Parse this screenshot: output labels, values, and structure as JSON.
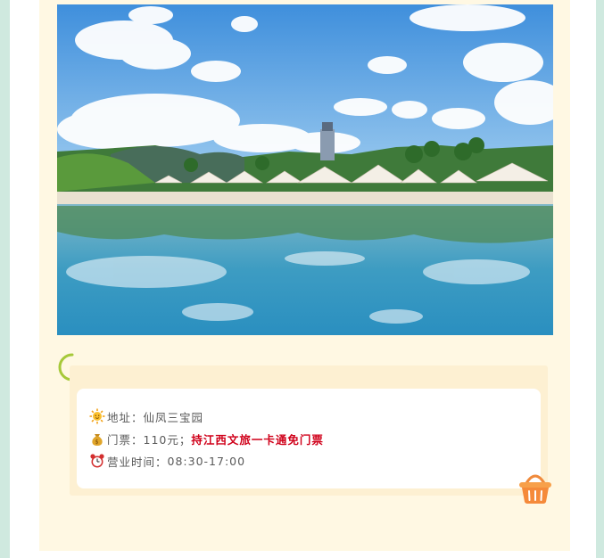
{
  "info": {
    "address_label": "地址：",
    "address_value": "仙凤三宝园",
    "ticket_label": "门票：",
    "ticket_value": "110元；",
    "ticket_note": "持江西文旅一卡通免门票",
    "hours_label": "营业时间：",
    "hours_value": "08:30-17:00"
  },
  "icons": {
    "address": "sun-icon",
    "ticket": "money-bag-icon",
    "hours": "alarm-clock-icon",
    "decor_ring": "ring-icon",
    "decor_basket": "basket-icon"
  },
  "colors": {
    "panel_bg": "#fff8e3",
    "card_shadow": "#fdf0d2",
    "side_accent": "#cfe9df",
    "highlight": "#d0021b",
    "text": "#595959"
  }
}
